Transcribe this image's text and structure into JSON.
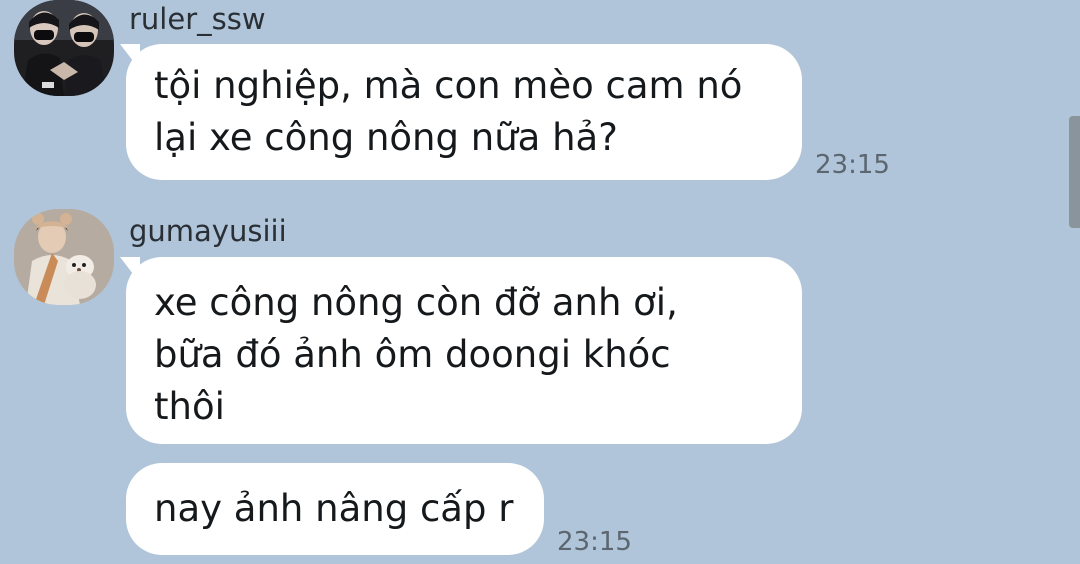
{
  "chat": {
    "messages": [
      {
        "sender": "ruler_ssw",
        "avatar": "avatar-ruler-ssw",
        "bubbles": [
          "tội nghiệp, mà con mèo cam nó\nlại xe công nông nữa hả?"
        ],
        "time": "23:15"
      },
      {
        "sender": "gumayusiii",
        "avatar": "avatar-gumayusiii",
        "bubbles": [
          "xe công nông còn đỡ anh ơi,\nbữa đó ảnh ôm doongi khóc\nthôi",
          "nay ảnh nâng cấp r"
        ],
        "time": "23:15"
      }
    ]
  },
  "colors": {
    "background": "#b0c5d9",
    "bubble": "#ffffff",
    "text": "#16191c",
    "timestamp": "#5b6670",
    "scrollbar": "#8a949c"
  }
}
